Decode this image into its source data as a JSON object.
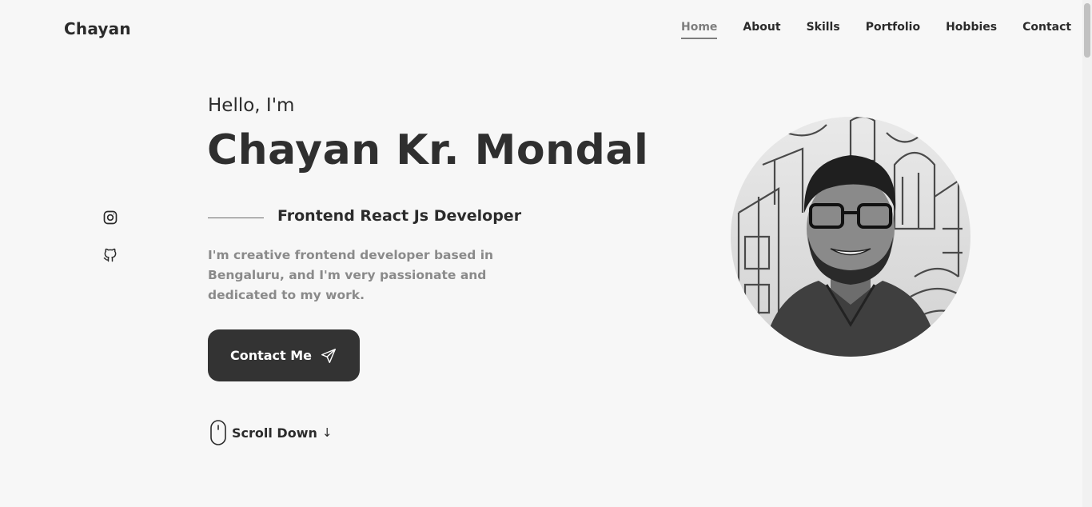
{
  "header": {
    "logo": "Chayan",
    "nav": [
      {
        "label": "Home",
        "active": true
      },
      {
        "label": "About"
      },
      {
        "label": "Skills"
      },
      {
        "label": "Portfolio"
      },
      {
        "label": "Hobbies"
      },
      {
        "label": "Contact"
      }
    ]
  },
  "social": [
    {
      "icon": "instagram-icon"
    },
    {
      "icon": "github-icon"
    }
  ],
  "hero": {
    "greeting": "Hello, I'm",
    "name": "Chayan Kr. Mondal",
    "role": "Frontend React Js Developer",
    "description": "I'm creative frontend developer based in Bengaluru, and I'm very passionate and dedicated to my work.",
    "contact_button": {
      "label": "Contact Me",
      "icon": "send-icon"
    },
    "scroll_down": {
      "label": "Scroll Down",
      "icon": "mouse-icon",
      "arrow": "↓"
    }
  },
  "profile_image": {
    "icon": "profile-photo"
  },
  "colors": {
    "background": "#f7f7f7",
    "text": "#2b2b2b",
    "muted": "#8a8a8a",
    "button": "#333333",
    "nav_active": "#7d7d7d"
  }
}
